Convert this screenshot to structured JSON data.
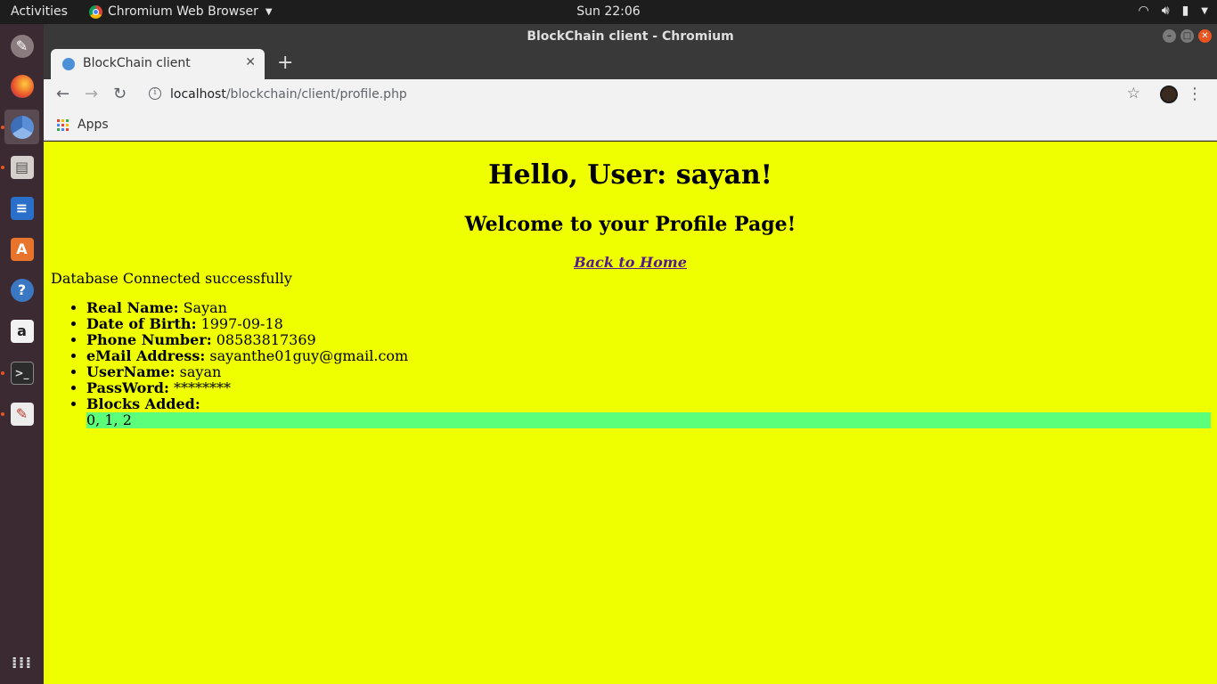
{
  "topbar": {
    "activities": "Activities",
    "app_name": "Chromium Web Browser",
    "clock": "Sun 22:06"
  },
  "dock": {
    "items": [
      "files-icon",
      "firefox-icon",
      "chromium-icon",
      "file-manager-icon",
      "writer-icon",
      "software-icon",
      "help-icon",
      "amazon-icon",
      "terminal-icon",
      "text-editor-icon",
      "app-grid-icon"
    ]
  },
  "window": {
    "title": "BlockChain client - Chromium"
  },
  "tab": {
    "title": "BlockChain client",
    "close": "✕",
    "new_tab": "+"
  },
  "omnibox": {
    "host": "localhost",
    "path": "/blockchain/client/profile.php"
  },
  "bookmarks": {
    "apps": "Apps"
  },
  "page": {
    "heading": "Hello, User: sayan!",
    "subheading": "Welcome to your Profile Page!",
    "home_link": "Back to Home",
    "status": "Database Connected successfully",
    "fields": [
      {
        "label": "Real Name:",
        "value": "Sayan"
      },
      {
        "label": "Date of Birth:",
        "value": "1997-09-18"
      },
      {
        "label": "Phone Number:",
        "value": "08583817369"
      },
      {
        "label": "eMail Address:",
        "value": "sayanthe01guy@gmail.com"
      },
      {
        "label": "UserName:",
        "value": "sayan"
      },
      {
        "label": "PassWord:",
        "value": "********"
      },
      {
        "label": "Blocks Added:",
        "value": ""
      }
    ],
    "blocks": "0, 1, 2"
  },
  "colors": {
    "page_bg": "#f0ff00",
    "blocks_bg": "#5cff7a",
    "dock_bg": "#3c2a33",
    "accent": "#e95420"
  }
}
